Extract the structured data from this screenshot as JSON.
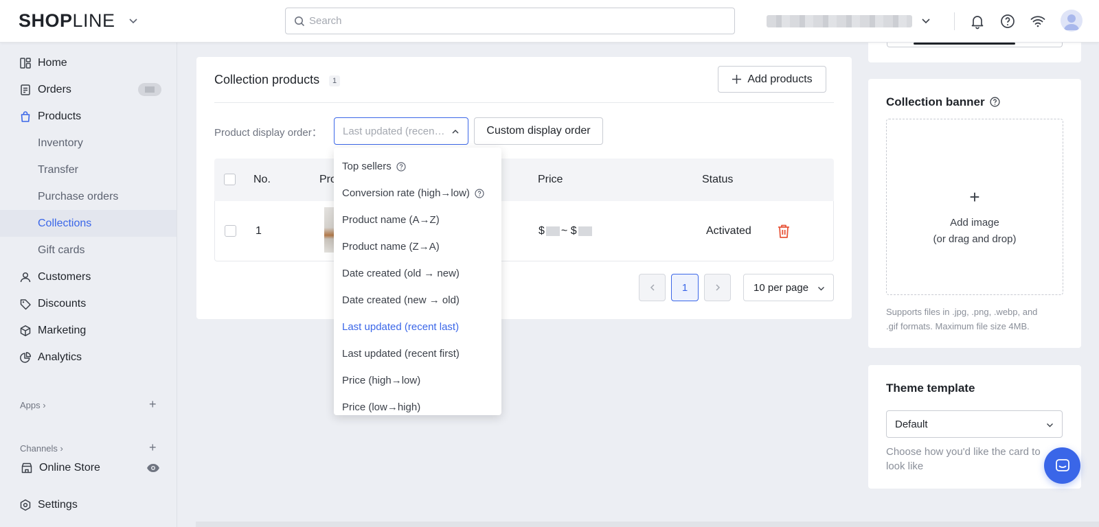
{
  "header": {
    "logo_bold": "SHOP",
    "logo_light": "LINE",
    "search_placeholder": "Search"
  },
  "sidebar": {
    "items": [
      {
        "label": "Home",
        "icon": "dashboard-icon"
      },
      {
        "label": "Orders",
        "icon": "orders-icon"
      },
      {
        "label": "Products",
        "icon": "bag-icon"
      },
      {
        "label": "Inventory"
      },
      {
        "label": "Transfer"
      },
      {
        "label": "Purchase orders"
      },
      {
        "label": "Collections"
      },
      {
        "label": "Gift cards"
      },
      {
        "label": "Customers",
        "icon": "person-icon"
      },
      {
        "label": "Discounts",
        "icon": "tag-icon"
      },
      {
        "label": "Marketing",
        "icon": "cube-icon"
      },
      {
        "label": "Analytics",
        "icon": "pie-chart-icon"
      }
    ],
    "apps_label": "Apps",
    "channels_label": "Channels",
    "online_store_label": "Online Store",
    "settings_label": "Settings"
  },
  "collection_products": {
    "title": "Collection products",
    "count": "1",
    "add_button": "Add products",
    "display_order_label": "Product display order：",
    "display_order_value": "Last updated (recent last)",
    "custom_order_button": "Custom display order",
    "columns": {
      "no": "No.",
      "product": "Pro",
      "price": "Price",
      "status": "Status"
    },
    "rows": [
      {
        "no": "1",
        "price_prefix": "$",
        "price_sep": "~ $",
        "status": "Activated"
      }
    ],
    "pagination": {
      "current_page": "1",
      "per_page": "10 per page"
    }
  },
  "sort_dropdown": {
    "options": [
      {
        "label": "Top sellers",
        "help": true
      },
      {
        "label": "Conversion rate (high→low)",
        "help": true
      },
      {
        "label": "Product name (A→Z)"
      },
      {
        "label": "Product name (Z→A)"
      },
      {
        "label": "Date created (old → new)"
      },
      {
        "label": "Date created (new → old)"
      },
      {
        "label": "Last updated (recent last)",
        "selected": true
      },
      {
        "label": "Last updated (recent first)"
      },
      {
        "label": "Price (high→low)"
      },
      {
        "label": "Price (low→high)"
      }
    ]
  },
  "collection_banner": {
    "title": "Collection banner",
    "add_image": "Add image",
    "drag_drop": "(or drag and drop)",
    "help_line1": "Supports files in .jpg, .png, .webp, and",
    "help_line2": ".gif formats. Maximum file size 4MB."
  },
  "theme_template": {
    "title": "Theme template",
    "value": "Default",
    "help_line1": "Choose how you'd like the card to",
    "help_line2": "look like"
  },
  "colors": {
    "accent": "#3a66e8",
    "danger": "#e8553a",
    "background": "#eceef3"
  }
}
